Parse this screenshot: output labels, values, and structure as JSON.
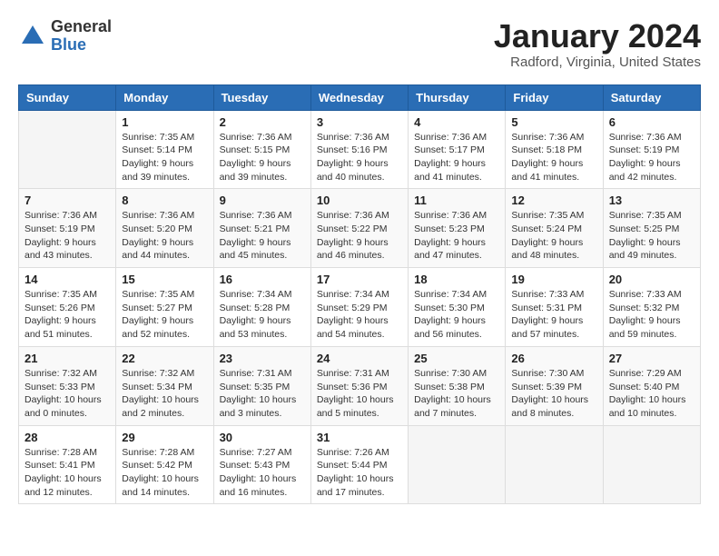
{
  "header": {
    "logo_general": "General",
    "logo_blue": "Blue",
    "month_title": "January 2024",
    "subtitle": "Radford, Virginia, United States"
  },
  "days_of_week": [
    "Sunday",
    "Monday",
    "Tuesday",
    "Wednesday",
    "Thursday",
    "Friday",
    "Saturday"
  ],
  "weeks": [
    [
      {
        "day": "",
        "info": ""
      },
      {
        "day": "1",
        "info": "Sunrise: 7:35 AM\nSunset: 5:14 PM\nDaylight: 9 hours\nand 39 minutes."
      },
      {
        "day": "2",
        "info": "Sunrise: 7:36 AM\nSunset: 5:15 PM\nDaylight: 9 hours\nand 39 minutes."
      },
      {
        "day": "3",
        "info": "Sunrise: 7:36 AM\nSunset: 5:16 PM\nDaylight: 9 hours\nand 40 minutes."
      },
      {
        "day": "4",
        "info": "Sunrise: 7:36 AM\nSunset: 5:17 PM\nDaylight: 9 hours\nand 41 minutes."
      },
      {
        "day": "5",
        "info": "Sunrise: 7:36 AM\nSunset: 5:18 PM\nDaylight: 9 hours\nand 41 minutes."
      },
      {
        "day": "6",
        "info": "Sunrise: 7:36 AM\nSunset: 5:19 PM\nDaylight: 9 hours\nand 42 minutes."
      }
    ],
    [
      {
        "day": "7",
        "info": "Sunrise: 7:36 AM\nSunset: 5:19 PM\nDaylight: 9 hours\nand 43 minutes."
      },
      {
        "day": "8",
        "info": "Sunrise: 7:36 AM\nSunset: 5:20 PM\nDaylight: 9 hours\nand 44 minutes."
      },
      {
        "day": "9",
        "info": "Sunrise: 7:36 AM\nSunset: 5:21 PM\nDaylight: 9 hours\nand 45 minutes."
      },
      {
        "day": "10",
        "info": "Sunrise: 7:36 AM\nSunset: 5:22 PM\nDaylight: 9 hours\nand 46 minutes."
      },
      {
        "day": "11",
        "info": "Sunrise: 7:36 AM\nSunset: 5:23 PM\nDaylight: 9 hours\nand 47 minutes."
      },
      {
        "day": "12",
        "info": "Sunrise: 7:35 AM\nSunset: 5:24 PM\nDaylight: 9 hours\nand 48 minutes."
      },
      {
        "day": "13",
        "info": "Sunrise: 7:35 AM\nSunset: 5:25 PM\nDaylight: 9 hours\nand 49 minutes."
      }
    ],
    [
      {
        "day": "14",
        "info": "Sunrise: 7:35 AM\nSunset: 5:26 PM\nDaylight: 9 hours\nand 51 minutes."
      },
      {
        "day": "15",
        "info": "Sunrise: 7:35 AM\nSunset: 5:27 PM\nDaylight: 9 hours\nand 52 minutes."
      },
      {
        "day": "16",
        "info": "Sunrise: 7:34 AM\nSunset: 5:28 PM\nDaylight: 9 hours\nand 53 minutes."
      },
      {
        "day": "17",
        "info": "Sunrise: 7:34 AM\nSunset: 5:29 PM\nDaylight: 9 hours\nand 54 minutes."
      },
      {
        "day": "18",
        "info": "Sunrise: 7:34 AM\nSunset: 5:30 PM\nDaylight: 9 hours\nand 56 minutes."
      },
      {
        "day": "19",
        "info": "Sunrise: 7:33 AM\nSunset: 5:31 PM\nDaylight: 9 hours\nand 57 minutes."
      },
      {
        "day": "20",
        "info": "Sunrise: 7:33 AM\nSunset: 5:32 PM\nDaylight: 9 hours\nand 59 minutes."
      }
    ],
    [
      {
        "day": "21",
        "info": "Sunrise: 7:32 AM\nSunset: 5:33 PM\nDaylight: 10 hours\nand 0 minutes."
      },
      {
        "day": "22",
        "info": "Sunrise: 7:32 AM\nSunset: 5:34 PM\nDaylight: 10 hours\nand 2 minutes."
      },
      {
        "day": "23",
        "info": "Sunrise: 7:31 AM\nSunset: 5:35 PM\nDaylight: 10 hours\nand 3 minutes."
      },
      {
        "day": "24",
        "info": "Sunrise: 7:31 AM\nSunset: 5:36 PM\nDaylight: 10 hours\nand 5 minutes."
      },
      {
        "day": "25",
        "info": "Sunrise: 7:30 AM\nSunset: 5:38 PM\nDaylight: 10 hours\nand 7 minutes."
      },
      {
        "day": "26",
        "info": "Sunrise: 7:30 AM\nSunset: 5:39 PM\nDaylight: 10 hours\nand 8 minutes."
      },
      {
        "day": "27",
        "info": "Sunrise: 7:29 AM\nSunset: 5:40 PM\nDaylight: 10 hours\nand 10 minutes."
      }
    ],
    [
      {
        "day": "28",
        "info": "Sunrise: 7:28 AM\nSunset: 5:41 PM\nDaylight: 10 hours\nand 12 minutes."
      },
      {
        "day": "29",
        "info": "Sunrise: 7:28 AM\nSunset: 5:42 PM\nDaylight: 10 hours\nand 14 minutes."
      },
      {
        "day": "30",
        "info": "Sunrise: 7:27 AM\nSunset: 5:43 PM\nDaylight: 10 hours\nand 16 minutes."
      },
      {
        "day": "31",
        "info": "Sunrise: 7:26 AM\nSunset: 5:44 PM\nDaylight: 10 hours\nand 17 minutes."
      },
      {
        "day": "",
        "info": ""
      },
      {
        "day": "",
        "info": ""
      },
      {
        "day": "",
        "info": ""
      }
    ]
  ]
}
